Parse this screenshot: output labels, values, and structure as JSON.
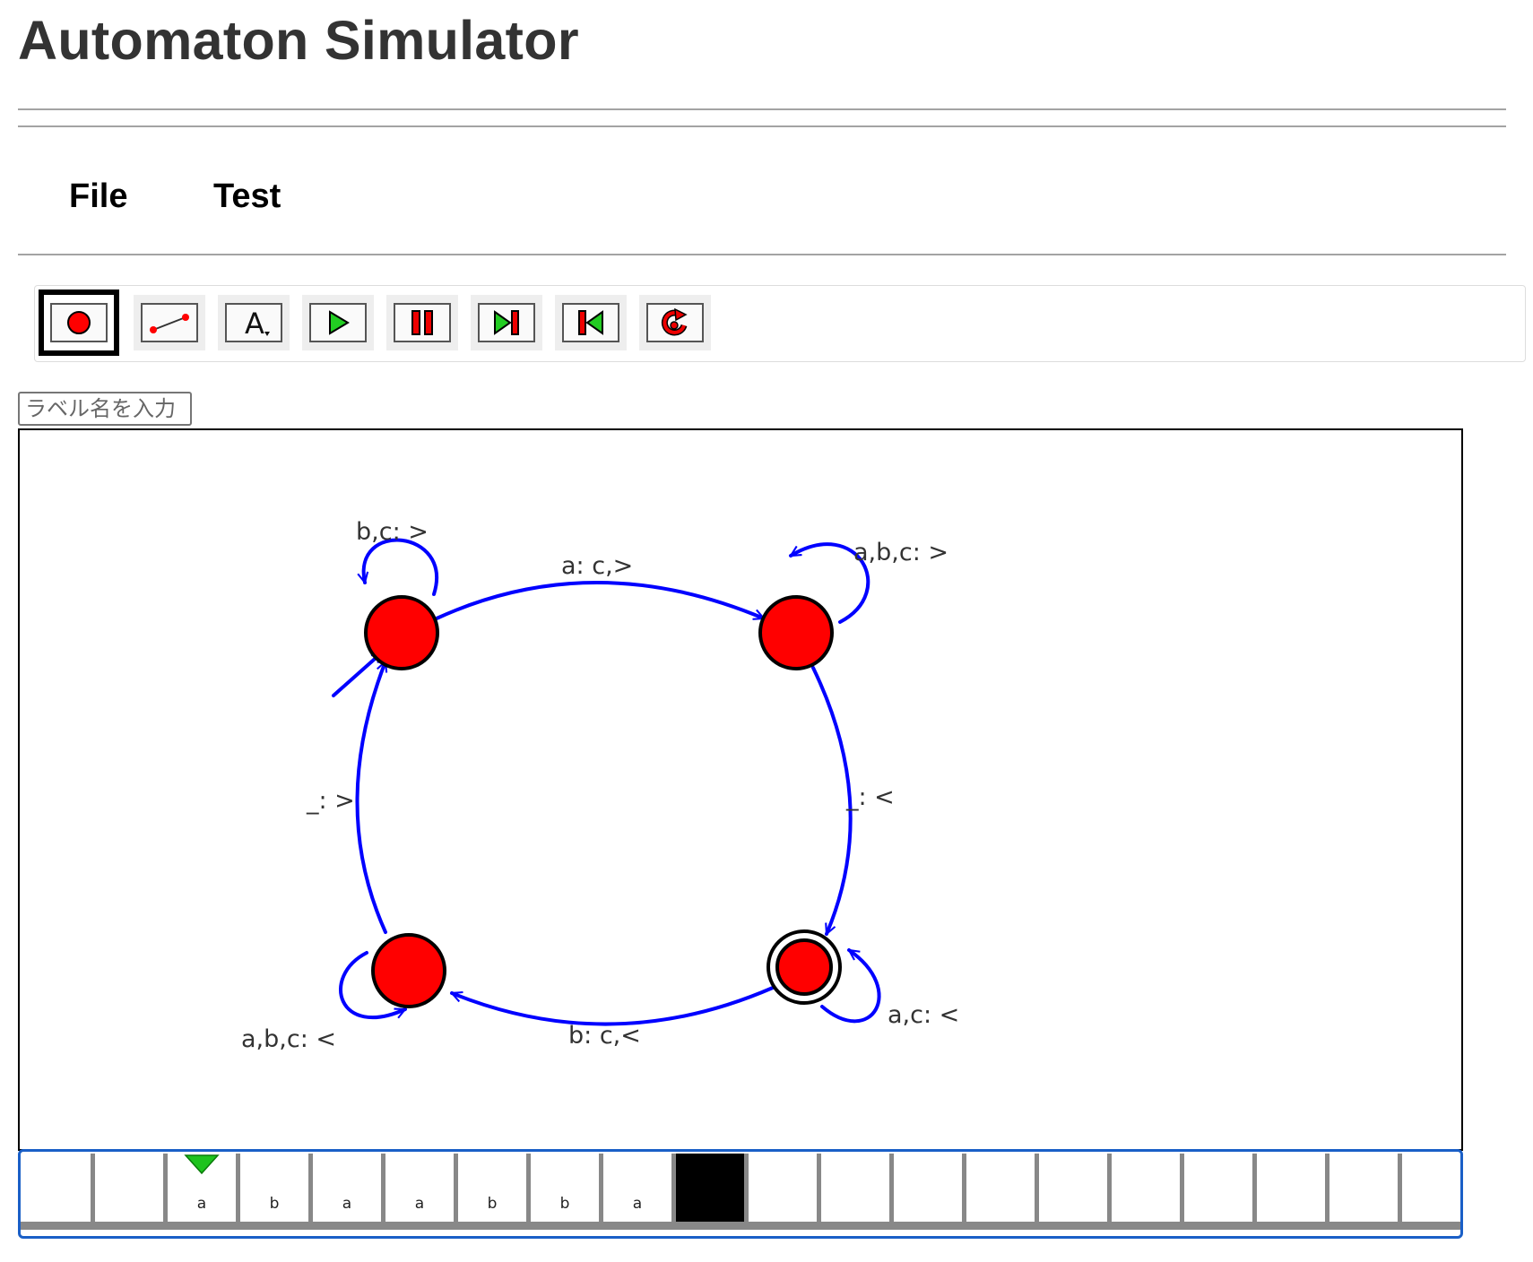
{
  "page": {
    "title": "Automaton Simulator"
  },
  "menu": {
    "items": [
      {
        "label": "File"
      },
      {
        "label": "Test"
      }
    ]
  },
  "toolbar": {
    "tools": [
      {
        "name": "add-state-tool",
        "icon": "red-dot-icon",
        "selected": true
      },
      {
        "name": "add-transition-tool",
        "icon": "line-icon",
        "selected": false
      },
      {
        "name": "add-label-tool",
        "icon": "text-a-icon",
        "selected": false
      },
      {
        "name": "play-tool",
        "icon": "play-icon",
        "selected": false
      },
      {
        "name": "pause-tool",
        "icon": "pause-icon",
        "selected": false
      },
      {
        "name": "step-forward-tool",
        "icon": "step-forward-icon",
        "selected": false
      },
      {
        "name": "step-back-tool",
        "icon": "step-back-icon",
        "selected": false
      },
      {
        "name": "reset-tool",
        "icon": "reset-icon",
        "selected": false
      }
    ]
  },
  "label_input": {
    "placeholder": "ラベル名を入力",
    "value": ""
  },
  "diagram": {
    "labels": {
      "q0_self": "b,c: >",
      "q1_self": "a,b,c: >",
      "q0_q1": "a: c,>",
      "q1_q2": "_: <",
      "q3_q0": "_: >",
      "q2_q3": "b: c,<",
      "q3_self": "a,b,c: <",
      "q2_self": "a,c: <"
    },
    "colors": {
      "state_fill": "#ff0000",
      "edge": "#0000ff",
      "state_stroke": "#000000"
    }
  },
  "tape": {
    "cells": [
      "",
      "",
      "a",
      "b",
      "a",
      "a",
      "b",
      "b",
      "a",
      "",
      "",
      "",
      "",
      "",
      "",
      "",
      "",
      "",
      "",
      ""
    ],
    "black_cell_index": 9,
    "head_index": 2,
    "head_color": "#1ec31e"
  }
}
